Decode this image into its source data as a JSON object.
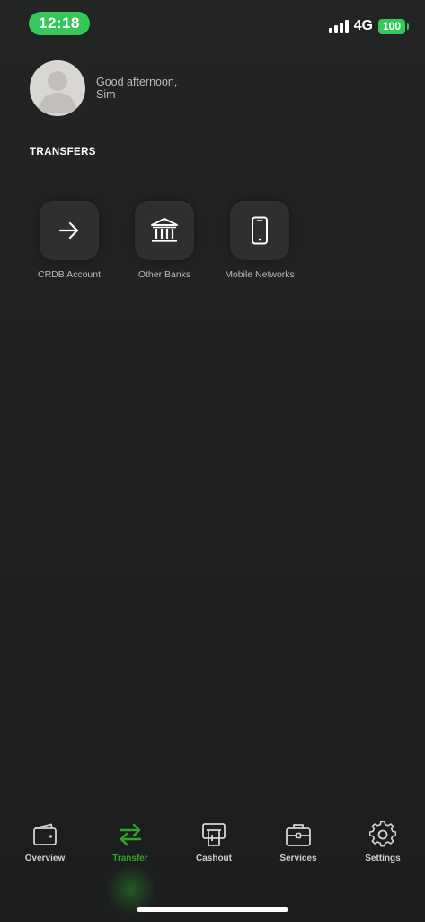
{
  "status_bar": {
    "time": "12:18",
    "network": "4G",
    "battery": "100",
    "accent_color": "#34c759"
  },
  "profile": {
    "greeting_line1": "Good afternoon,",
    "greeting_line2": "Sim"
  },
  "transfers": {
    "title": "TRANSFERS",
    "options": [
      {
        "label": "CRDB Account",
        "icon": "arrow-right-icon"
      },
      {
        "label": "Other Banks",
        "icon": "bank-icon"
      },
      {
        "label": "Mobile Networks",
        "icon": "mobile-phone-icon"
      }
    ]
  },
  "bottom_nav": {
    "active_color": "#2fa52f",
    "items": [
      {
        "label": "Overview",
        "icon": "wallet-icon",
        "active": false
      },
      {
        "label": "Transfer",
        "icon": "transfer-arrows-icon",
        "active": true
      },
      {
        "label": "Cashout",
        "icon": "atm-icon",
        "active": false
      },
      {
        "label": "Services",
        "icon": "briefcase-icon",
        "active": false
      },
      {
        "label": "Settings",
        "icon": "gear-icon",
        "active": false
      }
    ]
  }
}
